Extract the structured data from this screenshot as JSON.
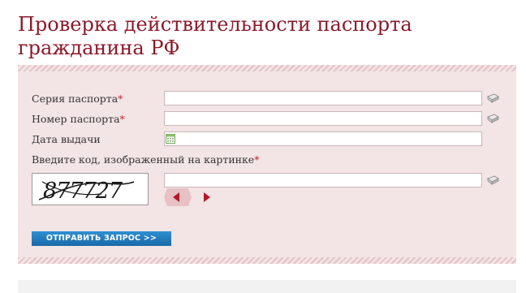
{
  "page": {
    "title_line1": "Проверка действительности паспорта",
    "title_line2": "гражданина РФ"
  },
  "form": {
    "series_label": "Серия паспорта",
    "number_label": "Номер паспорта",
    "date_label": "Дата выдачи",
    "captcha_label": "Введите код, изображенный на картинке",
    "required_mark": "*",
    "captcha_code": "877727",
    "series_value": "",
    "number_value": "",
    "date_value": "",
    "captcha_value": "",
    "submit_label": "ОТПРАВИТЬ ЗАПРОС >>"
  },
  "colors": {
    "title": "#8b1a2b",
    "panel_bg": "#f3e4e5",
    "required": "#c0272d",
    "button": "#1a6aa8",
    "arrow": "#b0192c"
  },
  "icons": [
    "keyboard-icon",
    "calendar-icon",
    "arrow-left-icon",
    "arrow-right-icon"
  ]
}
